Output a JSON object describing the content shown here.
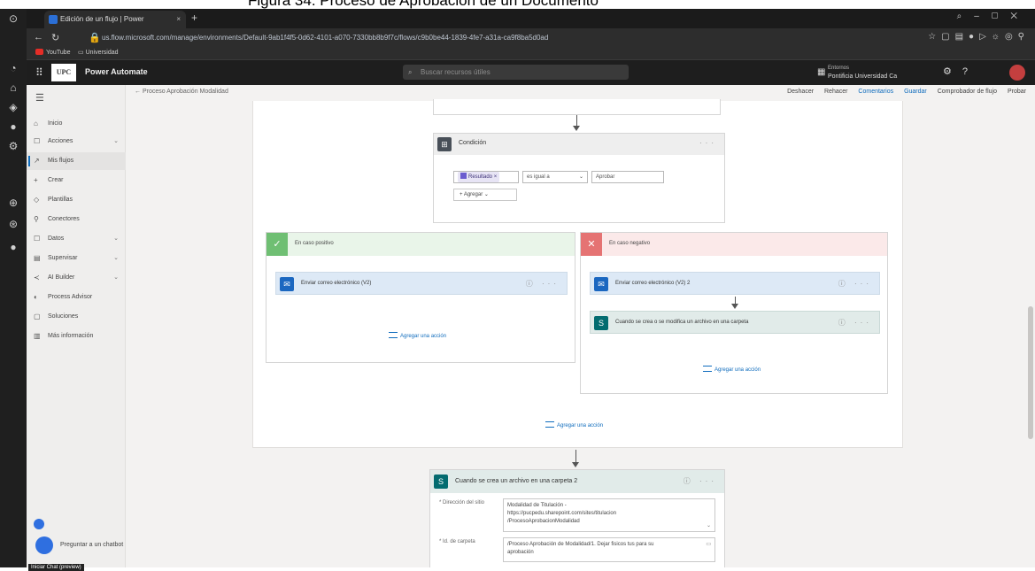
{
  "caption": "Figura 34. Proceso de Aprobación de un Documento",
  "browser": {
    "tab_title": "Edición de un flujo | Power",
    "url": "us.flow.microsoft.com/manage/environments/Default-9ab1f4f5-0d62-4101-a070-7330bb8b9f7c/flows/c9b0be44-1839-4fe7-a31a-ca9f8ba5d0ad",
    "bookmarks": [
      "YouTube",
      "Universidad"
    ]
  },
  "app": {
    "name": "Power Automate",
    "logo_text": "UPC",
    "search_placeholder": "Buscar recursos útiles",
    "env_label": "Entornos",
    "env_name": "Pontificia Universidad Ca"
  },
  "nav": {
    "items": [
      {
        "label": "Inicio",
        "icon": "⌂"
      },
      {
        "label": "Acciones",
        "icon": "☐",
        "chev": "⌄"
      },
      {
        "label": "Mis flujos",
        "icon": "↗"
      },
      {
        "label": "Crear",
        "icon": "+"
      },
      {
        "label": "Plantillas",
        "icon": "◇"
      },
      {
        "label": "Conectores",
        "icon": "⚲"
      },
      {
        "label": "Datos",
        "icon": "☐",
        "chev": "⌄"
      },
      {
        "label": "Supervisar",
        "icon": "▤",
        "chev": "⌄"
      },
      {
        "label": "AI Builder",
        "icon": "≺",
        "chev": "⌄"
      },
      {
        "label": "Process Advisor",
        "icon": "◐"
      },
      {
        "label": "Soluciones",
        "icon": "▢"
      },
      {
        "label": "Más información",
        "icon": "▥"
      }
    ],
    "chatbot": "Preguntar a un chatbot",
    "tooltip": "Iniciar Chat (preview)"
  },
  "cmdbar": {
    "breadcrumb": "← Proceso Aprobación Modalidad",
    "commands": [
      "Deshacer",
      "Rehacer",
      "Comentarios",
      "Guardar",
      "Comprobador de flujo",
      "Probar"
    ]
  },
  "flow": {
    "condition": {
      "title": "Condición",
      "token": "Resultado",
      "operator": "es igual a",
      "value": "Aprobar",
      "add": "Agregar"
    },
    "yes_branch": {
      "title": "En caso positivo",
      "action": "Enviar correo electrónico (V2)",
      "add": "Agregar una acción"
    },
    "no_branch": {
      "title": "En caso negativo",
      "action1": "Enviar correo electrónico (V2) 2",
      "action2": "Cuando se crea o se modifica un archivo en una carpeta",
      "add": "Agregar una acción"
    },
    "add_after": "Agregar una acción",
    "bottom_card": {
      "title": "Cuando se crea un archivo en una carpeta 2",
      "field1_label": "* Dirección del sitio",
      "field1_lines": [
        "Modalidad de Titulación -",
        "https://pucpedu.sharepoint.com/sites/titulacion",
        "/ProcesoAprobacionModalidad"
      ],
      "field2_label": "* Id. de carpeta",
      "field2_lines": [
        "/Proceso Aprobación de Modalidad/1. Dejar fisicos tus para su",
        "aprobación"
      ]
    }
  }
}
